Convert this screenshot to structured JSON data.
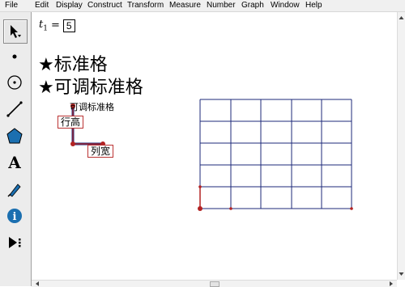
{
  "menu": [
    "File",
    "Edit",
    "Display",
    "Construct",
    "Transform",
    "Measure",
    "Number",
    "Graph",
    "Window",
    "Help"
  ],
  "tools": [
    {
      "name": "arrow-select-tool",
      "icon": "cursor-arrow-icon"
    },
    {
      "name": "point-tool",
      "icon": "point-icon"
    },
    {
      "name": "compass-tool",
      "icon": "circle-icon"
    },
    {
      "name": "straightedge-tool",
      "icon": "segment-icon"
    },
    {
      "name": "polygon-tool",
      "icon": "pentagon-icon"
    },
    {
      "name": "text-tool",
      "icon": "text-a-icon",
      "glyph": "A"
    },
    {
      "name": "marker-tool",
      "icon": "pen-icon"
    },
    {
      "name": "information-tool",
      "icon": "info-icon",
      "glyph": "i"
    },
    {
      "name": "custom-tool",
      "icon": "play-more-icon"
    }
  ],
  "parameter": {
    "name": "t",
    "subscript": "1",
    "equals": "=",
    "value": "5"
  },
  "headings": [
    "★标准格",
    "★可调标准格"
  ],
  "control": {
    "caption": "可调标准格",
    "row_height_label": "行高",
    "col_width_label": "列宽"
  },
  "colors": {
    "grid": "#1e2a7a",
    "point": "#b22222",
    "label_border": "#b33333",
    "selection_highlight": "#1e2a7a"
  }
}
